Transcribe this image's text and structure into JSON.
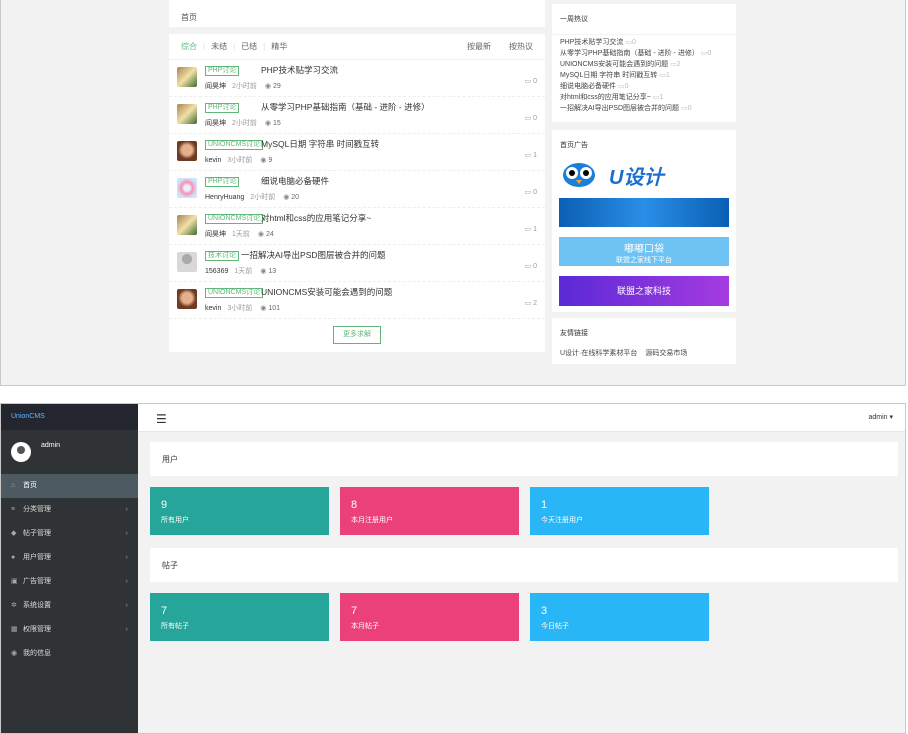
{
  "top": {
    "breadcrumb": "首页",
    "tabs": [
      "综合",
      "未结",
      "已结",
      "精华"
    ],
    "sort": [
      "按最新",
      "按热议"
    ],
    "posts": [
      {
        "tag": "PHP讨论",
        "title": "PHP技术贴学习交流",
        "author": "阎昊坤",
        "time": "2小时前",
        "views": "29",
        "comments": "0",
        "avatar": "cat"
      },
      {
        "tag": "PHP讨论",
        "title": "从零学习PHP基础指南（基础 - 进阶 - 进修）",
        "author": "阎昊坤",
        "time": "2小时前",
        "views": "15",
        "comments": "0",
        "avatar": "cat"
      },
      {
        "tag": "UNIONCMS讨论",
        "title": "MySQL日期 字符串 时间戳互转",
        "author": "kevin",
        "time": "3小时前",
        "views": "9",
        "comments": "1",
        "avatar": "monkey"
      },
      {
        "tag": "PHP讨论",
        "title": "细说电脑必备硬件",
        "author": "HenryHuang",
        "time": "2小时前",
        "views": "20",
        "comments": "0",
        "avatar": "blue"
      },
      {
        "tag": "UNIONCMS讨论",
        "title": "对html和css的应用笔记分享~",
        "author": "阎昊坤",
        "time": "1天前",
        "views": "24",
        "comments": "1",
        "avatar": "cat"
      },
      {
        "tag": "技术讨论",
        "title": "一招解决AI导出PSD图层被合并的问题",
        "author": "156369",
        "time": "1天前",
        "views": "13",
        "comments": "0",
        "avatar": "gray"
      },
      {
        "tag": "UNIONCMS讨论",
        "title": "UNIONCMS安装可能会遇到的问题",
        "author": "kevin",
        "time": "3小时前",
        "views": "101",
        "comments": "2",
        "avatar": "monkey"
      }
    ],
    "more_button": "更多求解",
    "hot_title": "一周热议",
    "hot": [
      {
        "t": "PHP技术贴学习交流",
        "c": "0"
      },
      {
        "t": "从零学习PHP基础指南（基础 - 进阶 - 进修）",
        "c": "0"
      },
      {
        "t": "UNIONCMS安装可能会遇到的问题",
        "c": "2"
      },
      {
        "t": "MySQL日期 字符串 时间戳互转",
        "c": "1"
      },
      {
        "t": "细说电脑必备硬件",
        "c": "0"
      },
      {
        "t": "对html和css的应用笔记分享~",
        "c": "1"
      },
      {
        "t": "一招解决AI导出PSD图层被合并的问题",
        "c": "0"
      }
    ],
    "ad_title": "首页广告",
    "ads": [
      "U设计",
      "嘟嘟口袋",
      "联盟之家科技"
    ],
    "ad_sub": "联盟之家线下平台",
    "links_title": "友情链接",
    "links": [
      "U设计·在线科学素材平台",
      "源码交易市场"
    ]
  },
  "admin": {
    "logo": "UnionCMS",
    "username": "admin",
    "header_user": "admin",
    "menu": [
      {
        "label": "首页",
        "icon": "⌂"
      },
      {
        "label": "分类管理",
        "icon": "≡"
      },
      {
        "label": "帖子管理",
        "icon": "◆"
      },
      {
        "label": "用户管理",
        "icon": "●"
      },
      {
        "label": "广告管理",
        "icon": "▣"
      },
      {
        "label": "系统设置",
        "icon": "✲"
      },
      {
        "label": "权限管理",
        "icon": "▦"
      },
      {
        "label": "我的信息",
        "icon": "◉"
      }
    ],
    "user_section": "用户",
    "post_section": "帖子",
    "user_stats": [
      {
        "n": "9",
        "l": "所有用户"
      },
      {
        "n": "8",
        "l": "本月注册用户"
      },
      {
        "n": "1",
        "l": "今天注册用户"
      }
    ],
    "post_stats": [
      {
        "n": "7",
        "l": "所有帖子"
      },
      {
        "n": "7",
        "l": "本月帖子"
      },
      {
        "n": "3",
        "l": "今日帖子"
      }
    ],
    "colors": {
      "green": "#26a69a",
      "pink": "#ec407a",
      "blue": "#29b6f6"
    }
  }
}
